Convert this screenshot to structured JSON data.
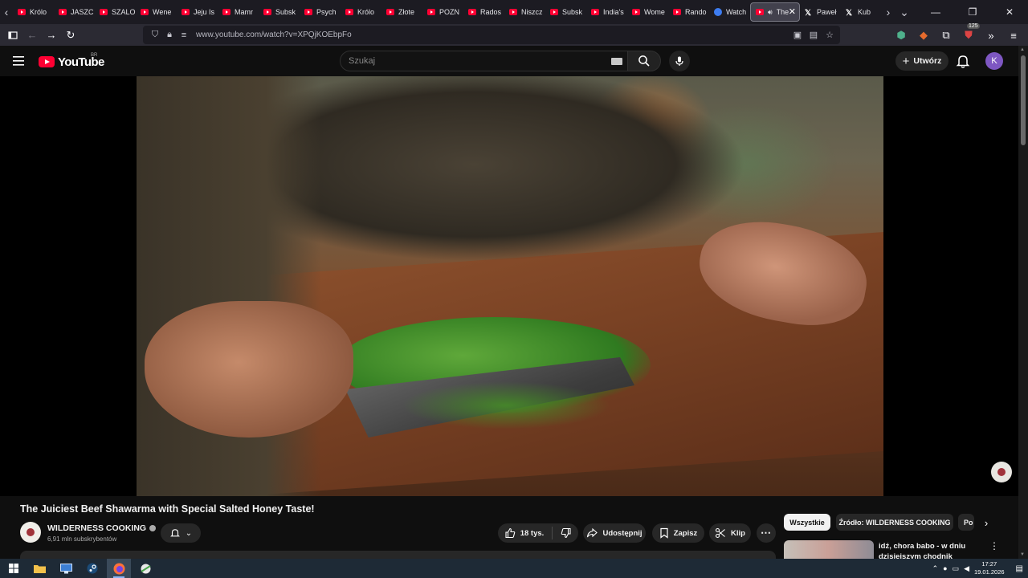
{
  "browser": {
    "tabs": [
      {
        "title": "Królo",
        "icon": "youtube-icon"
      },
      {
        "title": "JASZC",
        "icon": "youtube-icon"
      },
      {
        "title": "SZALO",
        "icon": "youtube-icon"
      },
      {
        "title": "Wene",
        "icon": "youtube-icon"
      },
      {
        "title": "Jeju Is",
        "icon": "youtube-icon"
      },
      {
        "title": "Mamr",
        "icon": "youtube-icon"
      },
      {
        "title": "Subsk",
        "icon": "youtube-icon"
      },
      {
        "title": "Psych",
        "icon": "youtube-icon"
      },
      {
        "title": "Królo",
        "icon": "youtube-icon"
      },
      {
        "title": "Złote",
        "icon": "youtube-icon"
      },
      {
        "title": "POZN",
        "icon": "youtube-icon"
      },
      {
        "title": "Rados",
        "icon": "youtube-icon"
      },
      {
        "title": "Niszcz",
        "icon": "youtube-icon"
      },
      {
        "title": "Subsk",
        "icon": "youtube-icon"
      },
      {
        "title": "India's",
        "icon": "youtube-icon"
      },
      {
        "title": "Wome",
        "icon": "youtube-icon"
      },
      {
        "title": "Rando",
        "icon": "youtube-icon"
      },
      {
        "title": "Watch",
        "icon": "globe-icon"
      },
      {
        "title": "The",
        "icon": "youtube-icon",
        "active": true
      },
      {
        "title": "Paweł",
        "icon": "x-icon"
      },
      {
        "title": "Kub",
        "icon": "x-icon"
      }
    ],
    "url": "www.youtube.com/watch?v=XPQjKOEbpFo",
    "extensions_badge": "125"
  },
  "youtube": {
    "logo_text": "YouTube",
    "region": "BR",
    "search_placeholder": "Szukaj",
    "create_label": "Utwórz",
    "avatar_letter": "K",
    "colors": {
      "accent": "#ff0033",
      "avatar": "#7e57c2",
      "chip_active_bg": "#f1f1f1"
    }
  },
  "video": {
    "title": "The Juiciest Beef Shawarma with Special Salted Honey Taste!",
    "channel_name": "WILDERNESS COOKING",
    "subscribers": "6,91 mln subskrybentów",
    "likes": "18 tys.",
    "share_label": "Udostępnij",
    "save_label": "Zapisz",
    "clip_label": "Klip"
  },
  "sidebar": {
    "chips": [
      "Wszystkie",
      "Źródło: WILDERNESS COOKING",
      "Po"
    ],
    "recommendation": {
      "title": "idź, chora babo - w dniu dzisiejszym chodnik pieszym"
    }
  },
  "taskbar": {
    "apps": [
      "windows-start-icon",
      "file-explorer-icon",
      "remote-desktop-icon",
      "steam-icon",
      "firefox-icon",
      "app-icon"
    ],
    "time": "17:27",
    "date": "19.01.2026"
  }
}
